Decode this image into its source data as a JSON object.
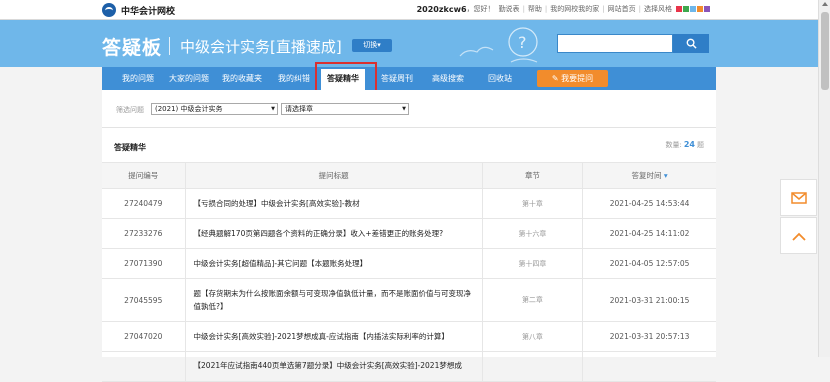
{
  "topbar": {
    "logo_text": "中华会计网校",
    "user": "2020zkcw6",
    "greeting": "，您好！",
    "links": [
      "勤说表",
      "帮助",
      "我的网校我的家",
      "网站首页",
      "选择风格"
    ],
    "style_swatches": [
      "#e8344a",
      "#3fa84d",
      "#6fb7ea",
      "#f28c2c",
      "#8a55b8"
    ]
  },
  "banner": {
    "title": "答疑板",
    "subtitle": "中级会计实务[直播速成]",
    "switch_label": "切换▾",
    "search_placeholder": "",
    "search_icon": "search-icon"
  },
  "nav": {
    "items": [
      "我的问题",
      "大家的问题",
      "我的收藏夹",
      "我的纠错",
      "答疑精华",
      "答疑周刊",
      "高级搜索",
      "回收站"
    ],
    "active": "答疑精华",
    "ask_button": "我要提问",
    "ask_icon": "pencil-icon"
  },
  "filter": {
    "label": "筛选问题",
    "year_select": "(2021) 中级会计实务",
    "chapter_select": "请选择章"
  },
  "section": {
    "title": "答疑精华",
    "count_label": "数量:",
    "count": "24",
    "count_unit": "题"
  },
  "table": {
    "headers": [
      "提问编号",
      "提问标题",
      "章节",
      "答复时间"
    ],
    "rows": [
      {
        "id": "27240479",
        "title": "【亏损合同的处理】中级会计实务[高效实验]-教材",
        "chapter": "第十章",
        "time": "2021-04-25 14:53:44"
      },
      {
        "id": "27233276",
        "title": "【经典题解170页第四题各个资料的正确分录】收入+差错更正的账务处理?",
        "chapter": "第十六章",
        "time": "2021-04-25 14:11:02"
      },
      {
        "id": "27071390",
        "title": "中级会计实务[超值精品]-其它问题【本题账务处理】",
        "chapter": "第十四章",
        "time": "2021-04-05 12:57:05"
      },
      {
        "id": "27045595",
        "title": "题【存货期末为什么按账面余额与可变现净值孰低计量，而不是账面价值与可变现净值孰低?】",
        "chapter": "第二章",
        "time": "2021-03-31 21:00:15"
      },
      {
        "id": "27047020",
        "title": "中级会计实务[高效实验]-2021梦想成真-应试指南【内插法实际利率的计算】",
        "chapter": "第八章",
        "time": "2021-03-31 20:57:13"
      },
      {
        "id": "",
        "title": "【2021年应试指南440页单选第7题分录】中级会计实务[高效实验]-2021梦想成",
        "chapter": "",
        "time": ""
      }
    ]
  },
  "side": {
    "mail_icon": "mail-icon",
    "top_icon": "chevron-up-icon"
  },
  "colors": {
    "banner": "#6fb7ea",
    "nav": "#3f8fd6",
    "accent_orange": "#f28c2c",
    "highlight_red": "#d93030"
  }
}
